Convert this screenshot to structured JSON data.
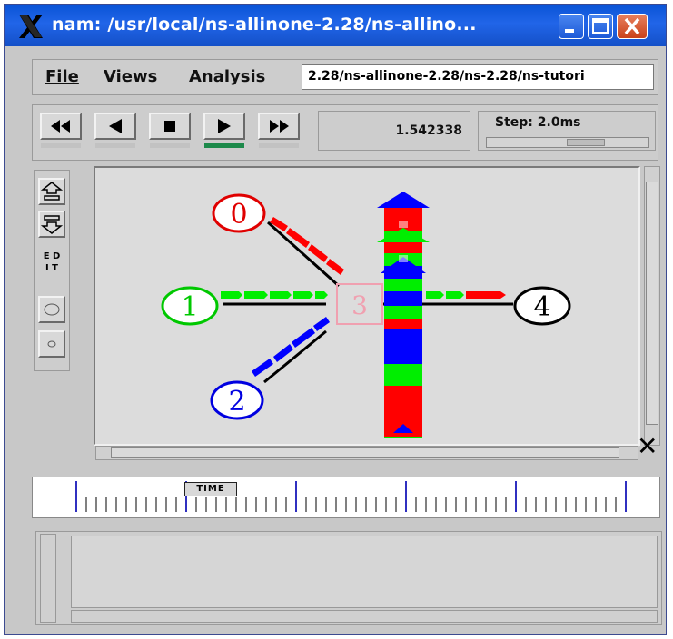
{
  "window": {
    "title": "nam: /usr/local/ns-allinone-2.28/ns-allino...",
    "minimize_icon": "minimize-icon",
    "maximize_icon": "maximize-icon",
    "close_icon": "close-icon"
  },
  "menubar": {
    "file_label": "File",
    "views_label": "Views",
    "analysis_label": "Analysis",
    "path_value": "2.28/ns-allinone-2.28/ns-2.28/ns-tutori"
  },
  "controls": {
    "rewind_icon": "fast-rewind-icon",
    "back_icon": "play-backward-icon",
    "stop_icon": "stop-icon",
    "play_icon": "play-forward-icon",
    "forward_icon": "fast-forward-icon",
    "current_time": "1.542338",
    "step_label": "Step: 2.0ms"
  },
  "sidebar": {
    "zoom_in_icon": "zoom-in-icon",
    "zoom_out_icon": "zoom-out-icon",
    "edit_line1": "E D",
    "edit_line2": "I T",
    "oval_icon": "oval-icon",
    "small_oval_icon": "small-oval-icon"
  },
  "network": {
    "nodes": [
      {
        "id": "0",
        "label": "0",
        "color": "#e00000"
      },
      {
        "id": "1",
        "label": "1",
        "color": "#00c800"
      },
      {
        "id": "2",
        "label": "2",
        "color": "#0000e0"
      },
      {
        "id": "3",
        "label": "3",
        "color": "#f0a0b0"
      },
      {
        "id": "4",
        "label": "4",
        "color": "#000000"
      }
    ],
    "colors": {
      "red": "#ff0000",
      "green": "#00ee00",
      "blue": "#0000ff",
      "black": "#000000"
    }
  },
  "timeline": {
    "time_label": "TIME"
  }
}
